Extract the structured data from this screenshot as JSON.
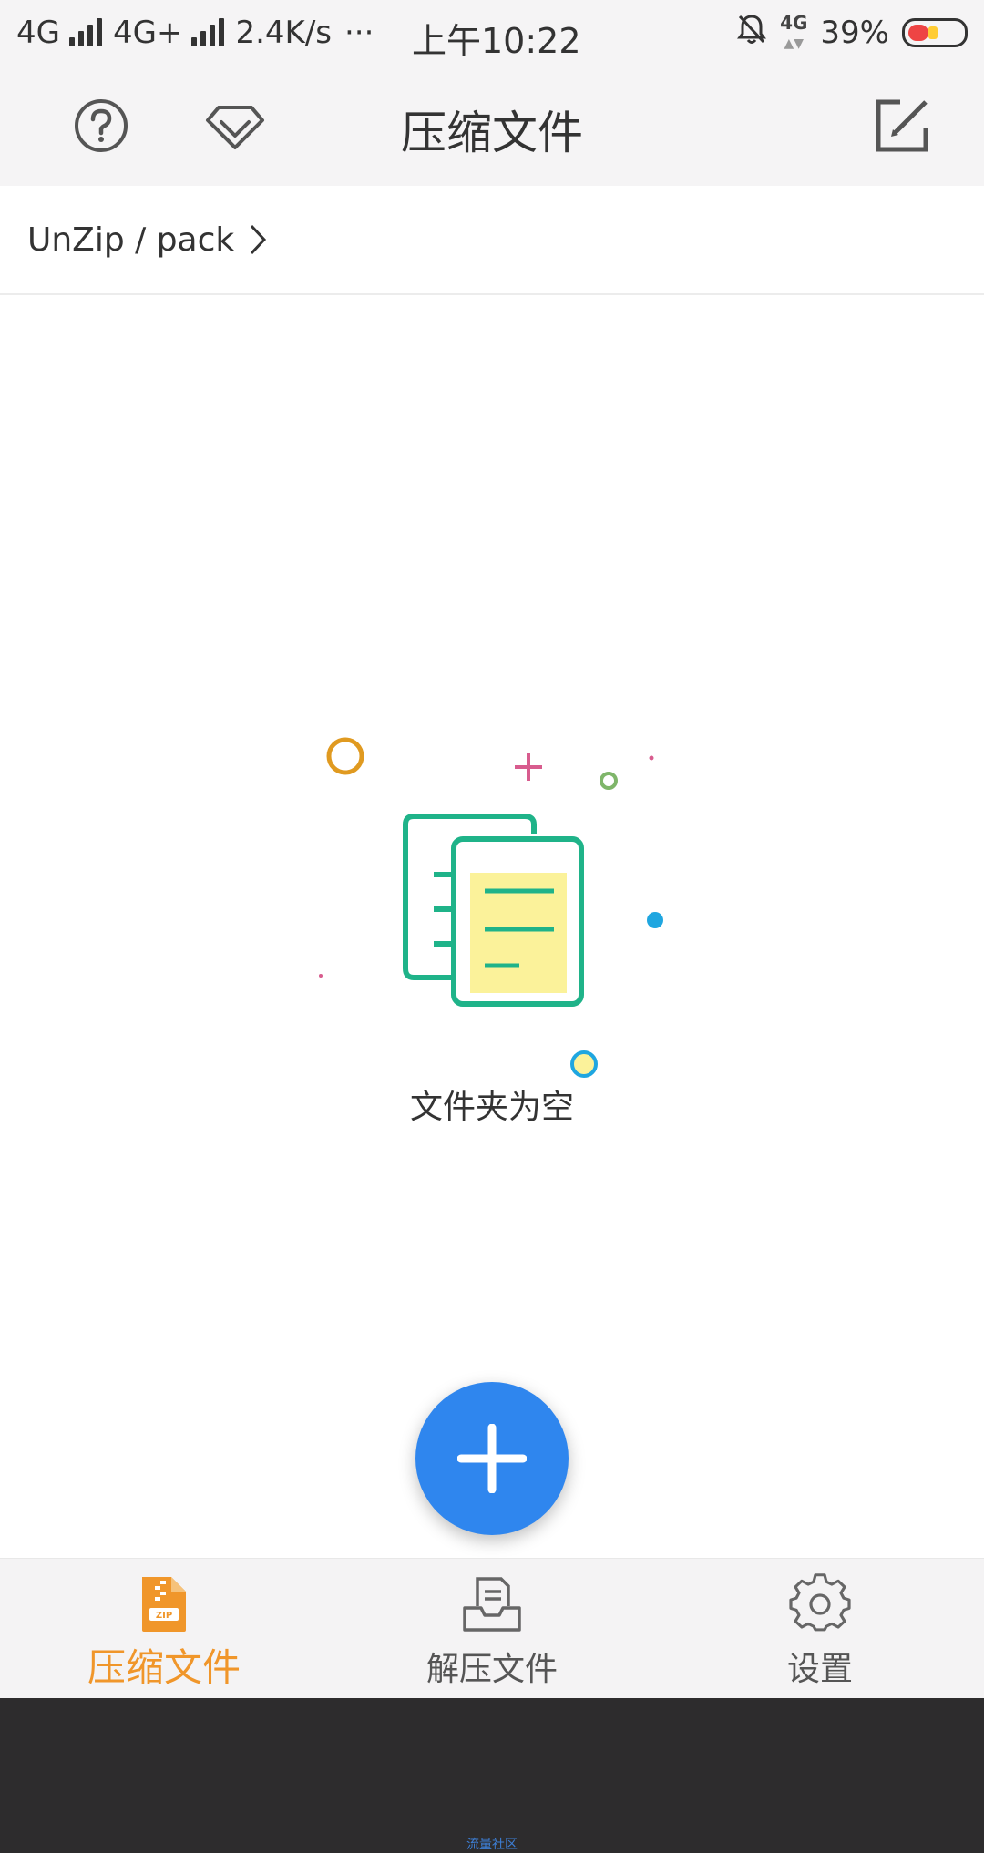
{
  "status_bar": {
    "net1": "4G",
    "net2": "4G+",
    "speed": "2.4K/s",
    "more": "···",
    "time": "上午10:22",
    "net3": "4G",
    "battery": "39%",
    "battery_level": 0.39
  },
  "app_bar": {
    "title": "压缩文件",
    "icons": [
      "help-icon",
      "vip-diamond-icon",
      "edit-icon"
    ]
  },
  "breadcrumb": {
    "path": "UnZip / pack"
  },
  "empty_state": {
    "message": "文件夹为空"
  },
  "fab": {
    "icon": "plus-icon"
  },
  "bottom_nav": {
    "items": [
      {
        "label": "压缩文件",
        "icon": "zip-file-icon",
        "active": true
      },
      {
        "label": "解压文件",
        "icon": "inbox-tray-icon",
        "active": false
      },
      {
        "label": "设置",
        "icon": "gear-icon",
        "active": false
      }
    ]
  },
  "colors": {
    "accent": "#f0962a",
    "fab": "#2f86ee",
    "illustration_green": "#1fb389",
    "illustration_yellow": "#fbf29a"
  },
  "system_bar": {
    "watermark": "流量社区"
  }
}
